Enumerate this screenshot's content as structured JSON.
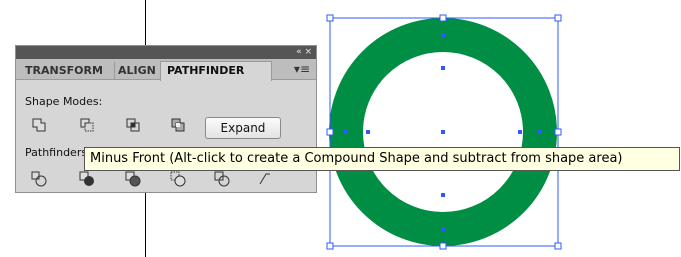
{
  "panel": {
    "close_controls": "«  ×",
    "tabs": [
      {
        "label": "TRANSFORM"
      },
      {
        "label": "ALIGN"
      },
      {
        "label": "PATHFINDER"
      }
    ],
    "menu_icon": "panel-menu-icon",
    "shape_modes_label": "Shape Modes:",
    "pathfinders_label": "Pathfinders:",
    "expand_label": "Expand",
    "shape_mode_icons": [
      "unite-icon",
      "minus-front-icon",
      "intersect-icon",
      "exclude-icon"
    ],
    "pathfinder_icons": [
      "divide-icon",
      "trim-icon",
      "merge-icon",
      "crop-icon",
      "outline-icon",
      "minus-back-icon"
    ]
  },
  "tooltip": {
    "text": "Minus Front (Alt-click to create a Compound Shape and subtract from shape area)"
  },
  "artwork": {
    "ring_color": "#008e44",
    "selection_color": "#2d5bff"
  }
}
